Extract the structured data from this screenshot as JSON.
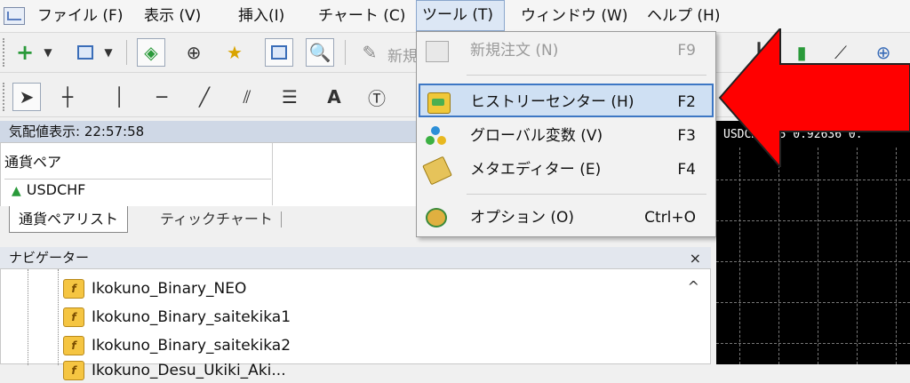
{
  "menubar": {
    "items": [
      {
        "label": "ファイル (F)"
      },
      {
        "label": "表示 (V)"
      },
      {
        "label": "挿入(I)"
      },
      {
        "label": "チャート (C)"
      },
      {
        "label": "ツール (T)"
      },
      {
        "label": "ウィンドウ (W)"
      },
      {
        "label": "ヘルプ (H)"
      }
    ]
  },
  "toolbar": {
    "truncated_label": "新規"
  },
  "tools_menu": {
    "items": [
      {
        "label": "新規注文 (N)",
        "shortcut": "F9",
        "disabled": true,
        "icon": "new-order-icon"
      },
      {
        "label": "ヒストリーセンター (H)",
        "shortcut": "F2",
        "highlighted": true,
        "icon": "history-center-icon"
      },
      {
        "label": "グローバル変数 (V)",
        "shortcut": "F3",
        "icon": "global-variables-icon"
      },
      {
        "label": "メタエディター (E)",
        "shortcut": "F4",
        "icon": "metaeditor-icon"
      },
      {
        "label": "オプション (O)",
        "shortcut": "Ctrl+O",
        "icon": "options-icon"
      }
    ]
  },
  "market_watch": {
    "title": "気配値表示: 22:57:58",
    "column_header": "通貨ペア",
    "rows": [
      {
        "symbol": "USDCHF"
      }
    ],
    "tabs": [
      {
        "label": "通貨ペアリスト",
        "selected": true
      },
      {
        "label": "ティックチャート",
        "selected": false
      }
    ]
  },
  "navigator": {
    "title": "ナビゲーター",
    "close_label": "×",
    "scroll_up_label": "^",
    "items": [
      {
        "label": "Ikokuno_Binary_NEO"
      },
      {
        "label": "Ikokuno_Binary_saitekika1"
      },
      {
        "label": "Ikokuno_Binary_saitekika2"
      },
      {
        "label": "Ikokuno_Desu_Ukiki_Aki..."
      }
    ]
  },
  "chart": {
    "label": "USDCHF,M5  0.92636 0."
  },
  "colors": {
    "highlight_border": "#3d77c4",
    "highlight_bg": "#cfe0f3",
    "arrow": "#ff0000"
  }
}
